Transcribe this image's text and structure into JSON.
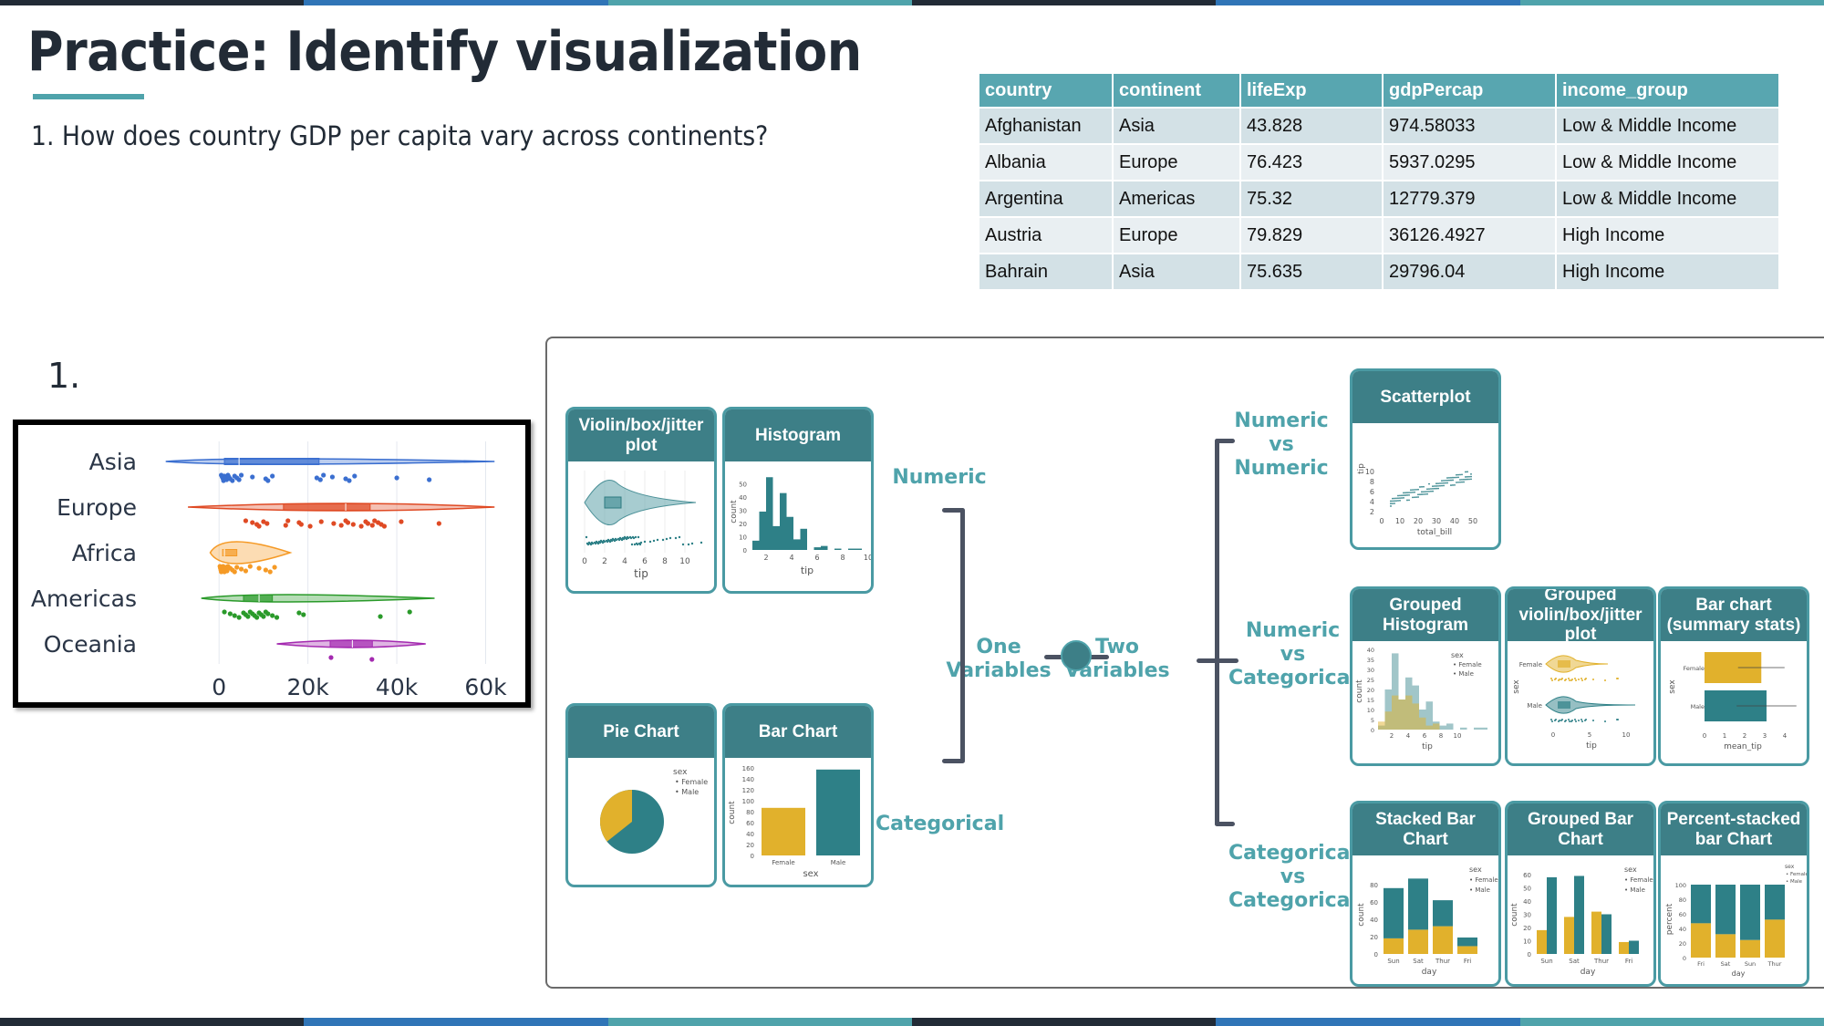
{
  "stripes": [
    "#222b36",
    "#3075b7",
    "#4fa3ab",
    "#222b36",
    "#3075b7",
    "#4fa3ab"
  ],
  "title": "Practice: Identify visualization",
  "question": "1. How does country GDP per capita vary across continents?",
  "table": {
    "headers": [
      "country",
      "continent",
      "lifeExp",
      "gdpPercap",
      "income_group"
    ],
    "rows": [
      [
        "Afghanistan",
        "Asia",
        "43.828",
        "974.58033",
        "Low & Middle Income"
      ],
      [
        "Albania",
        "Europe",
        "76.423",
        "5937.0295",
        "Low & Middle Income"
      ],
      [
        "Argentina",
        "Americas",
        "75.32",
        "12779.379",
        "Low & Middle Income"
      ],
      [
        "Austria",
        "Europe",
        "79.829",
        "36126.4927",
        "High Income"
      ],
      [
        "Bahrain",
        "Asia",
        "75.635",
        "29796.04",
        "High Income"
      ]
    ]
  },
  "figure_label": "1.",
  "chart_data": {
    "type": "violin",
    "orientation": "horizontal",
    "title": "",
    "xlabel": "",
    "ylabel": "",
    "x_ticks": [
      0,
      20000,
      40000,
      60000
    ],
    "x_tick_labels": [
      "0",
      "20k",
      "40k",
      "60k"
    ],
    "xlim": [
      -14000,
      64000
    ],
    "grid": true,
    "categories": [
      "Asia",
      "Europe",
      "Africa",
      "Americas",
      "Oceania"
    ],
    "series": [
      {
        "name": "Asia",
        "color": "#3b6fd0",
        "range": [
          -12000,
          62000
        ],
        "q1": 1200,
        "median": 4500,
        "q3": 22500,
        "points": [
          500,
          700,
          900,
          1000,
          1200,
          1500,
          1700,
          2000,
          2200,
          2500,
          3000,
          3500,
          4000,
          4500,
          5000,
          7500,
          10500,
          11000,
          12000,
          22000,
          22800,
          23500,
          25500,
          28500,
          29300,
          30500,
          40000,
          47300
        ]
      },
      {
        "name": "Europe",
        "color": "#df4a24",
        "range": [
          -7000,
          62000
        ],
        "q1": 14500,
        "median": 28500,
        "q3": 34000,
        "points": [
          6000,
          7500,
          8500,
          9000,
          10000,
          10800,
          15000,
          15500,
          18000,
          18500,
          20500,
          23000,
          25800,
          27500,
          28500,
          29000,
          30200,
          32000,
          33000,
          33500,
          34500,
          35000,
          35800,
          36500,
          37200,
          41000,
          49500
        ]
      },
      {
        "name": "Africa",
        "color": "#f59a26",
        "range": [
          -2000,
          16000
        ],
        "q1": 800,
        "median": 1200,
        "q3": 4000,
        "points": [
          200,
          300,
          400,
          500,
          600,
          700,
          800,
          900,
          1000,
          1100,
          1200,
          1400,
          1600,
          1800,
          2000,
          2500,
          3000,
          3500,
          4000,
          5000,
          6000,
          7000,
          9000,
          10500,
          11500,
          12500
        ]
      },
      {
        "name": "Americas",
        "color": "#2a9a2a",
        "range": [
          -4000,
          48500
        ],
        "q1": 5500,
        "median": 9000,
        "q3": 12000,
        "points": [
          1200,
          2500,
          3500,
          4500,
          5500,
          6000,
          6500,
          7000,
          7500,
          8000,
          8500,
          9000,
          9500,
          10000,
          10500,
          11000,
          12000,
          13000,
          18000,
          19000,
          36300,
          42900
        ]
      },
      {
        "name": "Oceania",
        "color": "#a42ab0",
        "range": [
          13000,
          46500
        ],
        "q1": 25000,
        "median": 30000,
        "q3": 34500,
        "points": [
          25200,
          34400
        ]
      }
    ]
  },
  "diagram": {
    "one_variables": [
      "One",
      "Variables"
    ],
    "two_variables": [
      "Two",
      "Variables"
    ],
    "numeric": "Numeric",
    "categorical": "Categorical",
    "num_vs_num": [
      "Numeric",
      "vs",
      "Numeric"
    ],
    "num_vs_cat": [
      "Numeric",
      "vs",
      "Categorical"
    ],
    "cat_vs_cat": [
      "Categorical",
      "vs",
      "Categorical"
    ],
    "cards": {
      "violin": {
        "title": "Violin/box/jitter plot",
        "xlabel": "tip",
        "ticks": [
          "0",
          "2",
          "4",
          "6",
          "8",
          "10"
        ]
      },
      "histogram": {
        "title": "Histogram",
        "xlabel": "tip",
        "ylabel": "count",
        "yticks": [
          "0",
          "10",
          "20",
          "30",
          "40",
          "50"
        ],
        "xticks": [
          "2",
          "4",
          "6",
          "8",
          "10"
        ],
        "values": [
          7,
          29,
          55,
          18,
          43,
          25,
          8,
          16,
          0,
          2,
          3,
          0,
          1,
          0,
          1,
          1
        ]
      },
      "pie": {
        "title": "Pie Chart",
        "legend_title": "sex",
        "legend": [
          "Female",
          "Male"
        ],
        "values": [
          87,
          157
        ]
      },
      "bar": {
        "title": "Bar Chart",
        "xlabel": "sex",
        "ylabel": "count",
        "categories": [
          "Female",
          "Male"
        ],
        "values": [
          87,
          157
        ],
        "yticks": [
          "0",
          "20",
          "40",
          "60",
          "80",
          "100",
          "120",
          "140",
          "160"
        ]
      },
      "scatter": {
        "title": "Scatterplot",
        "xlabel": "total_bill",
        "ylabel": "tip",
        "xticks": [
          "0",
          "10",
          "20",
          "30",
          "40",
          "50"
        ],
        "yticks": [
          "2",
          "4",
          "6",
          "8",
          "10"
        ]
      },
      "grouped_hist": {
        "title": "Grouped Histogram",
        "xlabel": "tip",
        "ylabel": "count",
        "legend_title": "sex",
        "legend": [
          "Female",
          "Male"
        ],
        "yticks": [
          "0",
          "5",
          "10",
          "15",
          "20",
          "25",
          "30",
          "35",
          "40"
        ],
        "xticks": [
          "2",
          "4",
          "6",
          "8",
          "10"
        ],
        "female": [
          4,
          9,
          17,
          15,
          17,
          13,
          6,
          2,
          3,
          0,
          0,
          0,
          0,
          0,
          0,
          0
        ],
        "male": [
          2,
          20,
          38,
          15,
          26,
          22,
          10,
          14,
          4,
          2,
          3,
          0,
          1,
          0,
          1,
          1
        ]
      },
      "grouped_violin": {
        "title": "Grouped violin/box/jitter plot",
        "xlabel": "tip",
        "ylabel": "sex",
        "categories": [
          "Female",
          "Male"
        ],
        "xticks": [
          "0",
          "5",
          "10"
        ]
      },
      "summary_bar": {
        "title": "Bar chart (summary stats)",
        "xlabel": "mean_tip",
        "ylabel": "sex",
        "categories": [
          "Female",
          "Male"
        ],
        "values": [
          2.83,
          3.09
        ],
        "errors": [
          1.16,
          1.49
        ],
        "xticks": [
          "0",
          "1",
          "2",
          "3",
          "4"
        ]
      },
      "stacked": {
        "title": "Stacked Bar Chart",
        "xlabel": "day",
        "ylabel": "count",
        "legend_title": "sex",
        "legend": [
          "Female",
          "Male"
        ],
        "categories": [
          "Sun",
          "Sat",
          "Thur",
          "Fri"
        ],
        "female": [
          18,
          28,
          32,
          9
        ],
        "male": [
          58,
          59,
          30,
          10
        ],
        "yticks": [
          "0",
          "20",
          "40",
          "60",
          "80"
        ]
      },
      "grouped_bar": {
        "title": "Grouped Bar Chart",
        "xlabel": "day",
        "ylabel": "count",
        "legend_title": "sex",
        "legend": [
          "Female",
          "Male"
        ],
        "categories": [
          "Sun",
          "Sat",
          "Thur",
          "Fri"
        ],
        "female": [
          18,
          28,
          32,
          9
        ],
        "male": [
          58,
          59,
          30,
          10
        ],
        "yticks": [
          "0",
          "10",
          "20",
          "30",
          "40",
          "50",
          "60"
        ]
      },
      "percent_stacked": {
        "title": "Percent-stacked bar Chart",
        "xlabel": "day",
        "ylabel": "percent",
        "legend_title": "sex",
        "legend": [
          "Female",
          "Male"
        ],
        "categories": [
          "Fri",
          "Sat",
          "Sun",
          "Thur"
        ],
        "female": [
          47,
          32,
          24,
          52
        ],
        "yticks": [
          "0",
          "20",
          "40",
          "60",
          "80",
          "100"
        ]
      }
    }
  },
  "colors": {
    "teal": "#3d7f87",
    "teal_light": "#4fa3ab",
    "female": "#e1b12c",
    "male": "#2e8087",
    "line": "#4b5262"
  }
}
